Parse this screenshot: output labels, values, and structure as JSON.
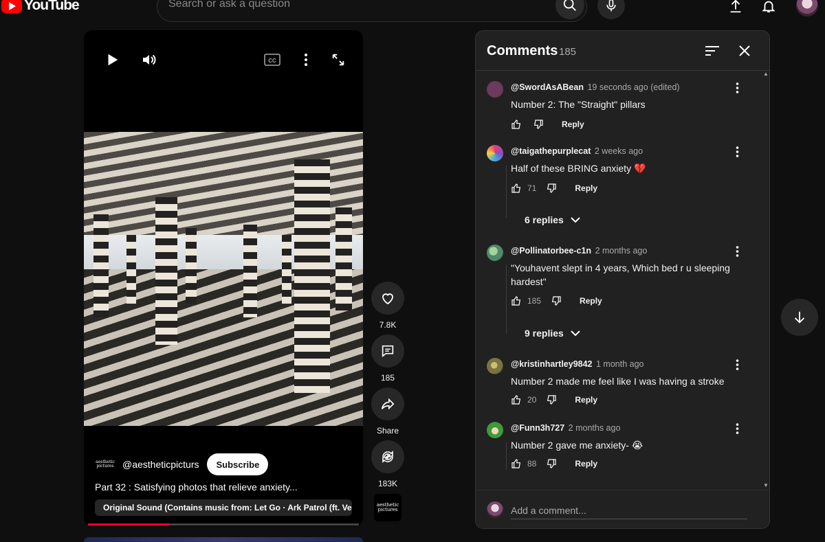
{
  "app": {
    "logo_text": "YouTube",
    "accent_color": "#ff0000"
  },
  "search": {
    "placeholder": "Search or ask a question"
  },
  "icons": {
    "search": "search-icon",
    "mic": "mic-icon",
    "upload": "upload-icon",
    "notifications": "bell-icon",
    "play": "play-icon",
    "volume": "volume-icon",
    "captions": "cc-icon",
    "more": "more-vert-icon",
    "fullscreen": "expand-icon",
    "like": "heart-icon",
    "comment": "comment-icon",
    "share": "share-icon",
    "remix": "remix-icon",
    "sort": "sort-icon",
    "close": "close-icon",
    "next": "arrow-down-icon"
  },
  "video": {
    "channel_handle": "@aestheticpicturs",
    "channel_logo_text": "aesthetic pictures",
    "subscribe_label": "Subscribe",
    "title": "Part 32 : Satisfying photos that relieve anxiety...",
    "sound": "Original Sound (Contains music from: Let Go · Ark Patrol (ft. Ve...",
    "progress": 0.3
  },
  "actions": {
    "likes": "7.8K",
    "comments": "185",
    "share_label": "Share",
    "remixes": "183K"
  },
  "comments_panel": {
    "title": "Comments",
    "count": "185",
    "add_placeholder": "Add a comment...",
    "items": [
      {
        "author": "@SwordAsABean",
        "time": "19 seconds ago (edited)",
        "text": "Number 2: The \"Straight\" pillars",
        "likes": "",
        "reply_label": "Reply",
        "avatar_color": "#6b3a5c"
      },
      {
        "author": "@taigathepurplecat",
        "time": "2 weeks ago",
        "text": "Half of these BRING anxiety 💔",
        "likes": "71",
        "reply_label": "Reply",
        "replies_label": "6 replies",
        "avatar_color": "#8a4fc0"
      },
      {
        "author": "@Pollinatorbee-c1n",
        "time": "2 months ago",
        "text": "\"Youhavent slept in 4 years, Which bed r u sleeping hardest\"",
        "likes": "185",
        "reply_label": "Reply",
        "replies_label": "9 replies",
        "avatar_color": "#4f8a6a"
      },
      {
        "author": "@kristinhartley9842",
        "time": "1 month ago",
        "text": "Number 2 made me feel like I was having a stroke",
        "likes": "20",
        "reply_label": "Reply",
        "avatar_color": "#7a7442"
      },
      {
        "author": "@Funn3h727",
        "time": "2 months ago",
        "text": "Number 2 gave me anxiety- 😭",
        "likes": "88",
        "reply_label": "Reply",
        "avatar_color": "#3f9a3a"
      }
    ]
  }
}
